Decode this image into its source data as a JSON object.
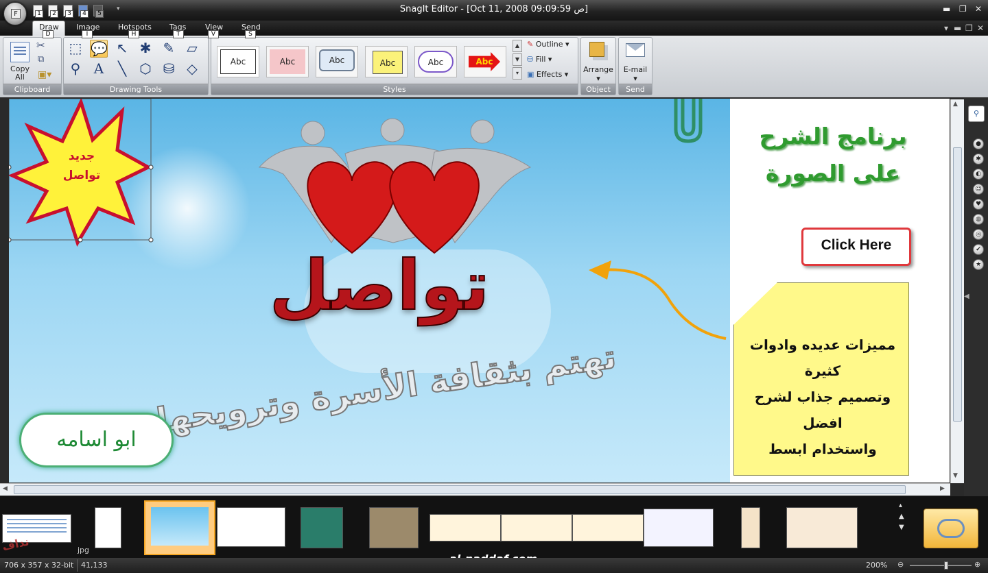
{
  "app": {
    "title": "SnagIt Editor - [Oct 11, 2008 09:09:59 ص]",
    "orb_key": "F"
  },
  "quick_access": {
    "keys": [
      "1",
      "2",
      "3",
      "4",
      "5"
    ]
  },
  "tabs": [
    {
      "label": "Draw",
      "key": "D"
    },
    {
      "label": "Image",
      "key": "I"
    },
    {
      "label": "Hotspots",
      "key": "H"
    },
    {
      "label": "Tags",
      "key": "T"
    },
    {
      "label": "View",
      "key": "V"
    },
    {
      "label": "Send",
      "key": "S"
    }
  ],
  "ribbon": {
    "clipboard": {
      "group_label": "Clipboard",
      "copy_all": "Copy All"
    },
    "drawing_tools": {
      "group_label": "Drawing Tools"
    },
    "styles": {
      "group_label": "Styles",
      "items": [
        "Abc",
        "Abc",
        "Abc",
        "Abc",
        "Abc",
        "Abc"
      ],
      "outline": "Outline",
      "fill": "Fill",
      "effects": "Effects"
    },
    "object": {
      "group_label": "Object",
      "arrange": "Arrange"
    },
    "send": {
      "group_label": "Send",
      "email": "E-mail"
    }
  },
  "canvas": {
    "starburst_text": "جديد\nتواصل",
    "logo_text": "تواصل",
    "tagline": "تهتم بثقافة الأسرة وترويحها",
    "bottom_cloud": "ابو اسامه",
    "heading_right": "برنامج الشرح\nعلى الصورة",
    "click_here": "Click Here",
    "note_text": "مميزات عديده وادوات كثيرة\nوتصميم جذاب لشرح افضل\nواستخدام ابسط"
  },
  "tray": {
    "jpg_label": "jpg",
    "watermark": "al-naddaf.com",
    "tiny_logo": "نداف"
  },
  "status": {
    "dims": "706 x 357 x 32-bit",
    "size": "41,133",
    "zoom": "200%"
  }
}
